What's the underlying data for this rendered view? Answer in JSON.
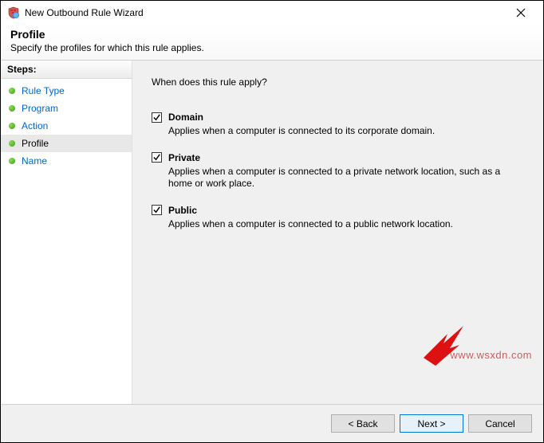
{
  "window": {
    "title": "New Outbound Rule Wizard"
  },
  "header": {
    "title": "Profile",
    "subtitle": "Specify the profiles for which this rule applies."
  },
  "sidebar": {
    "heading": "Steps:",
    "items": [
      {
        "label": "Rule Type",
        "active": false
      },
      {
        "label": "Program",
        "active": false
      },
      {
        "label": "Action",
        "active": false
      },
      {
        "label": "Profile",
        "active": true
      },
      {
        "label": "Name",
        "active": false
      }
    ]
  },
  "content": {
    "question": "When does this rule apply?",
    "options": [
      {
        "label": "Domain",
        "checked": true,
        "description": "Applies when a computer is connected to its corporate domain."
      },
      {
        "label": "Private",
        "checked": true,
        "description": "Applies when a computer is connected to a private network location, such as a home or work place."
      },
      {
        "label": "Public",
        "checked": true,
        "description": "Applies when a computer is connected to a public network location."
      }
    ]
  },
  "footer": {
    "back": "< Back",
    "next": "Next >",
    "cancel": "Cancel"
  },
  "watermark": "www.wsxdn.com"
}
